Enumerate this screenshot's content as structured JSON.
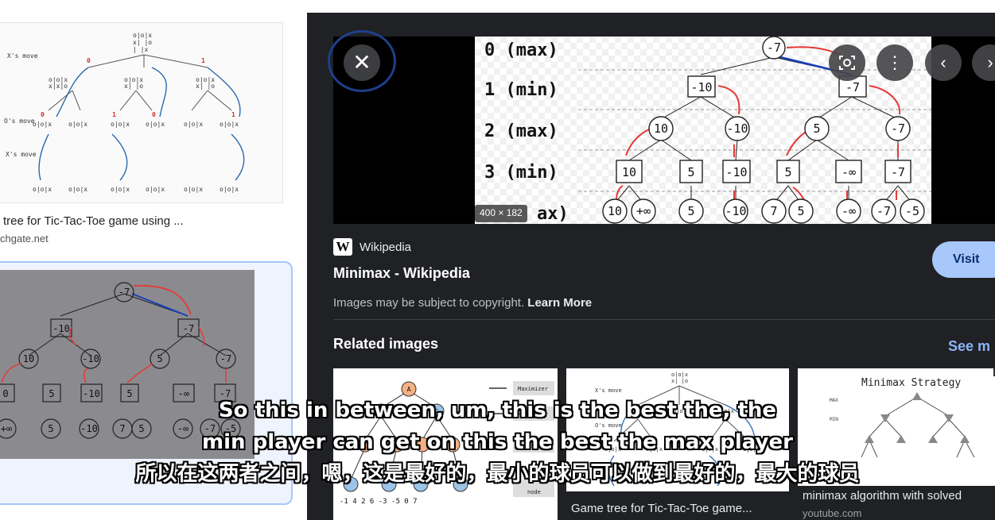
{
  "left_results": {
    "result1_title": "tree for Tic-Tac-Toe game using ...",
    "result1_source": "chgate.net",
    "thumb1_labels": [
      "X's move",
      "O's move",
      "X's move"
    ]
  },
  "preview": {
    "dimensions": "400 × 182",
    "tree_depth_labels": [
      "0 (max)",
      "1 (min)",
      "2 (max)",
      "3 (min)",
      "ax)"
    ],
    "tree_nodes": {
      "level0": [
        "-7"
      ],
      "level1": [
        "-10",
        "-7"
      ],
      "level2": [
        "10",
        "-10",
        "5",
        "-7"
      ],
      "level3": [
        "10",
        "5",
        "-10",
        "5",
        "-∞",
        "-7"
      ],
      "level4": [
        "10",
        "+∞",
        "5",
        "-10",
        "7",
        "5",
        "-∞",
        "-7",
        "-5"
      ]
    },
    "close_icon": "close-icon",
    "lens_icon": "lens-icon",
    "more_icon": "more-vert-icon",
    "prev_icon": "chevron-left-icon",
    "next_icon": "chevron-right-icon"
  },
  "source": {
    "logo": "W",
    "name": "Wikipedia",
    "page_title": "Minimax - Wikipedia",
    "visit_label": "Visit",
    "copyright_text": "Images may be subject to copyright.",
    "learn_more": "Learn More"
  },
  "related": {
    "heading": "Related images",
    "see_more": "See m",
    "items": [
      {
        "caption": "",
        "labels": [
          "Maximizer",
          "Minimizer",
          "Maximizer",
          "node"
        ],
        "bottom_numbers": "-1  4  2  6  -3  -5  0  7"
      },
      {
        "caption": "Game tree for Tic-Tac-Toe game...",
        "labels": [
          "X's move",
          "O's move"
        ]
      },
      {
        "caption": "minimax algorithm with solved",
        "source": "youtube.com",
        "title": "Minimax Strategy",
        "labels": [
          "MAX",
          "MIN"
        ]
      }
    ]
  },
  "subtitles": {
    "line1": "So this in between, um, this is the best the, the",
    "line2": "min player can get on this the best the max player",
    "line3": "所以在这两者之间，嗯，这是最好的，最小的球员可以做到最好的，最大的球员"
  },
  "colors": {
    "panel_bg": "#202124",
    "visit_bg": "#a8c7fa",
    "link": "#8ab4f8",
    "tree_red": "#e53935",
    "tree_blue": "#1a3fb8"
  }
}
